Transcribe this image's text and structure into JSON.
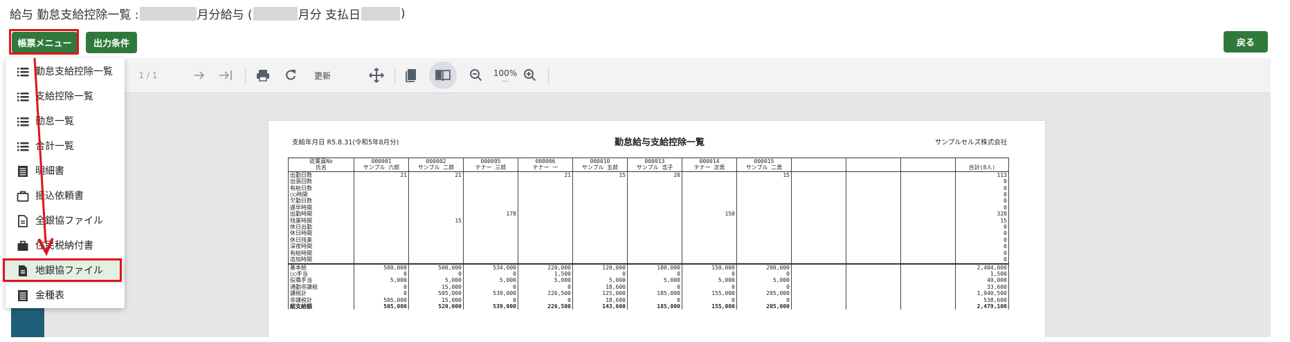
{
  "header": {
    "title_prefix": "給与 勤怠支給控除一覧 : ",
    "title_part2": "月分給与 (",
    "title_part3": "月分 支払日",
    "title_suffix": ")"
  },
  "buttons": {
    "menu": "帳票メニュー",
    "conditions": "出力条件",
    "back": "戻る"
  },
  "toolbar": {
    "page_indicator": "1 / 1",
    "refresh": "更新",
    "zoom": "100%",
    "zoom_dots": "…"
  },
  "menu": {
    "items": [
      {
        "label": "勤怠支給控除一覧",
        "icon": "list-icon"
      },
      {
        "label": "支給控除一覧",
        "icon": "list-icon"
      },
      {
        "label": "勤怠一覧",
        "icon": "list-icon"
      },
      {
        "label": "合計一覧",
        "icon": "list-icon"
      },
      {
        "label": "明細書",
        "icon": "document-lines-icon"
      },
      {
        "label": "振込依頼書",
        "icon": "briefcase-outline-icon"
      },
      {
        "label": "全銀協ファイル",
        "icon": "file-text-icon"
      },
      {
        "label": "住民税納付書",
        "icon": "briefcase-filled-icon"
      },
      {
        "label": "地銀協ファイル",
        "icon": "file-text-filled-icon",
        "highlighted": true
      },
      {
        "label": "金種表",
        "icon": "document-lines-icon"
      }
    ]
  },
  "report": {
    "pay_date": "支給年月日 R5.8.31(令和5年8月分)",
    "title": "勤怠給与支給控除一覧",
    "company": "サンプルセルズ株式会社",
    "header_labels": [
      "従業員No",
      "氏名"
    ],
    "employees": [
      {
        "no": "000001",
        "name": "サンプル 六郎"
      },
      {
        "no": "000002",
        "name": "サンプル 二郎"
      },
      {
        "no": "000005",
        "name": "テナー 三郎"
      },
      {
        "no": "000006",
        "name": "テナー 一"
      },
      {
        "no": "000010",
        "name": "サンプル 五郎"
      },
      {
        "no": "000013",
        "name": "サンプル 浩子"
      },
      {
        "no": "000014",
        "name": "テナー 次男"
      },
      {
        "no": "000015",
        "name": "サンプル 二男"
      }
    ],
    "total_header": "合計(8人)",
    "attendance_rows": [
      {
        "label": "出勤日数",
        "values": [
          "21",
          "21",
          "",
          "21",
          "15",
          "20",
          "",
          "15"
        ],
        "total": "113"
      },
      {
        "label": "出張回数",
        "values": [
          "",
          "",
          "",
          "",
          "",
          "",
          "",
          ""
        ],
        "total": "0"
      },
      {
        "label": "有給日数",
        "values": [
          "",
          "",
          "",
          "",
          "",
          "",
          "",
          ""
        ],
        "total": "0"
      },
      {
        "label": "○○時間",
        "values": [
          "",
          "",
          "",
          "",
          "",
          "",
          "",
          ""
        ],
        "total": "0"
      },
      {
        "label": "欠勤日数",
        "values": [
          "",
          "",
          "",
          "",
          "",
          "",
          "",
          ""
        ],
        "total": "0"
      },
      {
        "label": "遅早時間",
        "values": [
          "",
          "",
          "",
          "",
          "",
          "",
          "",
          ""
        ],
        "total": "0"
      },
      {
        "label": "出勤時間",
        "values": [
          "",
          "",
          "178",
          "",
          "",
          "",
          "150",
          ""
        ],
        "total": "328"
      },
      {
        "label": "残業時間",
        "values": [
          "",
          "15",
          "",
          "",
          "",
          "",
          "",
          ""
        ],
        "total": "15"
      },
      {
        "label": "休日出勤",
        "values": [
          "",
          "",
          "",
          "",
          "",
          "",
          "",
          ""
        ],
        "total": "0"
      },
      {
        "label": "休日時間",
        "values": [
          "",
          "",
          "",
          "",
          "",
          "",
          "",
          ""
        ],
        "total": "0"
      },
      {
        "label": "休日残業",
        "values": [
          "",
          "",
          "",
          "",
          "",
          "",
          "",
          ""
        ],
        "total": "0"
      },
      {
        "label": "深夜時間",
        "values": [
          "",
          "",
          "",
          "",
          "",
          "",
          "",
          ""
        ],
        "total": "0"
      },
      {
        "label": "有給時間",
        "values": [
          "",
          "",
          "",
          "",
          "",
          "",
          "",
          ""
        ],
        "total": "0"
      },
      {
        "label": "追加時間",
        "values": [
          "",
          "",
          "",
          "",
          "",
          "",
          "",
          ""
        ],
        "total": "0"
      }
    ],
    "pay_rows": [
      {
        "label": "基本給",
        "values": [
          "500,000",
          "500,000",
          "534,000",
          "220,000",
          "120,000",
          "180,000",
          "150,000",
          "200,000"
        ],
        "total": "2,404,000"
      },
      {
        "label": "○○手当",
        "values": [
          "0",
          "0",
          "0",
          "1,500",
          "0",
          "0",
          "0",
          "0"
        ],
        "total": "1,500"
      },
      {
        "label": "役職手当",
        "values": [
          "5,000",
          "5,000",
          "5,000",
          "5,000",
          "5,000",
          "5,000",
          "5,000",
          "5,000"
        ],
        "total": "40,000"
      },
      {
        "label": "通勤非課税",
        "values": [
          "0",
          "15,000",
          "0",
          "0",
          "18,600",
          "0",
          "0",
          "0"
        ],
        "total": "33,600"
      },
      {
        "label": "課税計",
        "values": [
          "0",
          "505,000",
          "539,000",
          "226,500",
          "125,000",
          "185,000",
          "155,000",
          "205,000"
        ],
        "total": "1,940,500"
      },
      {
        "label": "非課税計",
        "values": [
          "505,000",
          "15,000",
          "0",
          "0",
          "18,600",
          "0",
          "0",
          "0"
        ],
        "total": "538,600"
      },
      {
        "label": "総支給額",
        "values": [
          "505,000",
          "520,000",
          "539,000",
          "226,500",
          "143,600",
          "185,000",
          "155,000",
          "205,000"
        ],
        "total": "2,479,100",
        "bold": true
      }
    ]
  },
  "colors": {
    "button_green": "#2f7a3b",
    "highlight_red": "#e0121b",
    "active_item_bg": "#e4efe4"
  }
}
